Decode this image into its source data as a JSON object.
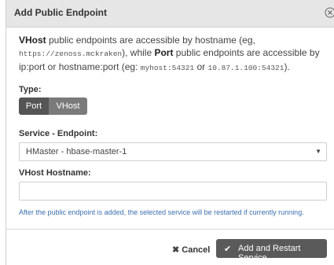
{
  "dialog": {
    "title": "Add Public Endpoint",
    "close_icon": "close-circle-icon"
  },
  "description": {
    "p1_bold": "VHost",
    "p1_text": " public endpoints are accessible by hostname (eg,",
    "example_vhost": "https://zenoss.mckraken",
    "p2_text": "), while ",
    "p2_bold": "Port",
    "p3_text": " public endpoints are accessible by ip:port or hostname:port (eg: ",
    "example_port1": "myhost:54321",
    "or_text": " or ",
    "example_port2": "10.87.1.100:54321",
    "end_text": ")."
  },
  "type": {
    "label": "Type:",
    "options": [
      "Port",
      "VHost"
    ],
    "selected": "Port"
  },
  "service_endpoint": {
    "label": "Service - Endpoint:",
    "value": "HMaster - hbase-master-1"
  },
  "vhost_hostname": {
    "label": "VHost Hostname:",
    "value": ""
  },
  "note": "After the public endpoint is added, the selected service will be restarted if currently running.",
  "footer": {
    "cancel_label": "Cancel",
    "add_label": "Add and Restart Service"
  },
  "colors": {
    "header_bg": "#e6e6e6",
    "button_dark": "#5a5a5a",
    "link_blue": "#3b6fb0"
  }
}
